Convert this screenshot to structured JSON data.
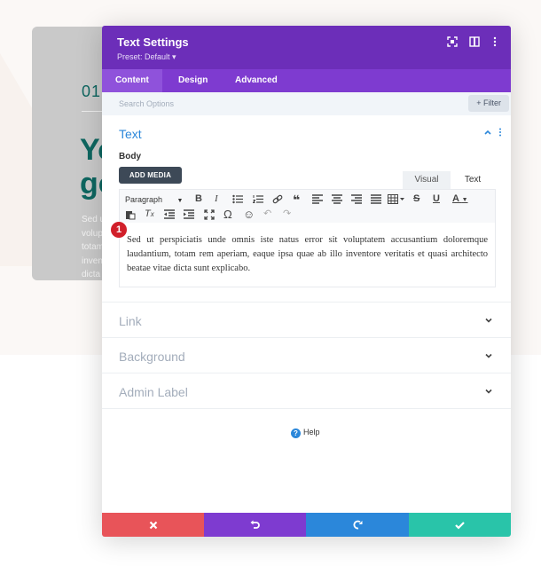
{
  "background": {
    "number": "01",
    "title_fragment": "Yo\ngo",
    "text_fragment": [
      "Sed u",
      "volup",
      "totam",
      "inven",
      "dicta"
    ]
  },
  "modal": {
    "title": "Text Settings",
    "preset": "Preset: Default ▾",
    "header_icons": [
      "fullscreen-icon",
      "split-view-icon",
      "more-vertical-icon"
    ],
    "tabs": [
      {
        "label": "Content",
        "active": true
      },
      {
        "label": "Design",
        "active": false
      },
      {
        "label": "Advanced",
        "active": false
      }
    ],
    "search_placeholder": "Search Options",
    "filter_label": "Filter",
    "section": {
      "title": "Text",
      "body_label": "Body",
      "add_media": "ADD MEDIA",
      "mode_tabs": [
        "Visual",
        "Text"
      ],
      "toolbar": {
        "format_select": "Paragraph",
        "row1_icons": [
          "bold-icon",
          "italic-icon",
          "bullet-list-icon",
          "numbered-list-icon",
          "link-icon",
          "quote-icon",
          "align-left-icon",
          "align-center-icon",
          "align-right-icon",
          "justify-icon",
          "table-icon",
          "strikethrough-icon",
          "underline-icon",
          "text-color-icon"
        ],
        "row2_icons": [
          "paste-text-icon",
          "clear-format-icon",
          "outdent-icon",
          "indent-icon",
          "fullscreen-icon",
          "special-char-icon",
          "emoji-icon",
          "undo-icon",
          "redo-icon"
        ]
      },
      "content": "Sed ut perspiciatis unde omnis iste natus error sit voluptatem accusantium doloremque laudantium, totam rem aperiam, eaque ipsa quae ab illo inventore veritatis et quasi architecto beatae vitae dicta sunt explicabo.",
      "badge": "1"
    },
    "accordions": [
      "Link",
      "Background",
      "Admin Label"
    ],
    "help": "Help",
    "footer": {
      "cancel_color": "#e85459",
      "undo_color": "#7e3bd0",
      "redo_color": "#2b87da",
      "save_color": "#29c4a9"
    }
  }
}
